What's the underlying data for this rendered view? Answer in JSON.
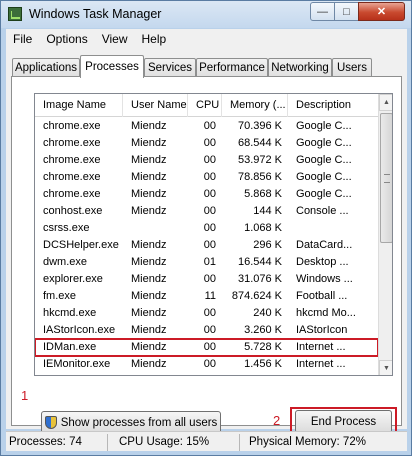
{
  "window": {
    "title": "Windows Task Manager",
    "minimize": "—",
    "maximize": "□",
    "close": "✕"
  },
  "menu": [
    "File",
    "Options",
    "View",
    "Help"
  ],
  "tabs": [
    "Applications",
    "Processes",
    "Services",
    "Performance",
    "Networking",
    "Users"
  ],
  "active_tab": "Processes",
  "columns": [
    "Image Name",
    "User Name",
    "CPU",
    "Memory (...",
    "Description"
  ],
  "processes": [
    [
      "chrome.exe",
      "Miendz",
      "00",
      "70.396 K",
      "Google C..."
    ],
    [
      "chrome.exe",
      "Miendz",
      "00",
      "68.544 K",
      "Google C..."
    ],
    [
      "chrome.exe",
      "Miendz",
      "00",
      "53.972 K",
      "Google C..."
    ],
    [
      "chrome.exe",
      "Miendz",
      "00",
      "78.856 K",
      "Google C..."
    ],
    [
      "chrome.exe",
      "Miendz",
      "00",
      "5.868 K",
      "Google C..."
    ],
    [
      "conhost.exe",
      "Miendz",
      "00",
      "144 K",
      "Console ..."
    ],
    [
      "csrss.exe",
      "",
      "00",
      "1.068 K",
      ""
    ],
    [
      "DCSHelper.exe",
      "Miendz",
      "00",
      "296 K",
      "DataCard..."
    ],
    [
      "dwm.exe",
      "Miendz",
      "01",
      "16.544 K",
      "Desktop ..."
    ],
    [
      "explorer.exe",
      "Miendz",
      "00",
      "31.076 K",
      "Windows ..."
    ],
    [
      "fm.exe",
      "Miendz",
      "11",
      "874.624 K",
      "Football ..."
    ],
    [
      "hkcmd.exe",
      "Miendz",
      "00",
      "240 K",
      "hkcmd Mo..."
    ],
    [
      "IAStorIcon.exe",
      "Miendz",
      "00",
      "3.260 K",
      "IAStorIcon"
    ],
    [
      "IDMan.exe",
      "Miendz",
      "00",
      "5.728 K",
      "Internet ..."
    ],
    [
      "IEMonitor.exe",
      "Miendz",
      "00",
      "1.456 K",
      "Internet ..."
    ]
  ],
  "selected_index": 13,
  "markers": {
    "selected_row": "1",
    "end_process": "2"
  },
  "buttons": {
    "show_all": "Show processes from all users",
    "end_process": "End Process"
  },
  "status": {
    "processes": "Processes: 74",
    "cpu": "CPU Usage: 15%",
    "memory": "Physical Memory: 72%"
  },
  "accent_color": "#cc1b26"
}
